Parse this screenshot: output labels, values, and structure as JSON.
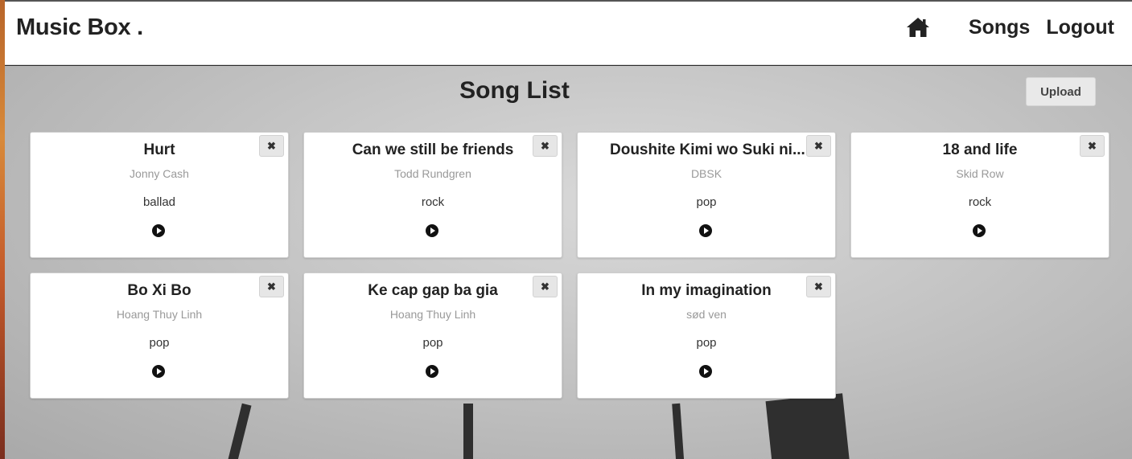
{
  "navbar": {
    "brand": "Music Box .",
    "links": [
      "Songs",
      "Logout"
    ]
  },
  "main": {
    "title": "Song List",
    "upload_label": "Upload",
    "delete_glyph": "✖",
    "songs": [
      {
        "title": "Hurt",
        "artist": "Jonny Cash",
        "genre": "ballad"
      },
      {
        "title": "Can we still be friends",
        "artist": "Todd Rundgren",
        "genre": "rock"
      },
      {
        "title": "Doushite Kimi wo Suki ni...",
        "artist": "DBSK",
        "genre": "pop"
      },
      {
        "title": "18 and life",
        "artist": "Skid Row",
        "genre": "rock"
      },
      {
        "title": "Bo Xi Bo",
        "artist": "Hoang Thuy Linh",
        "genre": "pop"
      },
      {
        "title": "Ke cap gap ba gia",
        "artist": "Hoang Thuy Linh",
        "genre": "pop"
      },
      {
        "title": "In my imagination",
        "artist": "sød ven",
        "genre": "pop"
      }
    ]
  }
}
